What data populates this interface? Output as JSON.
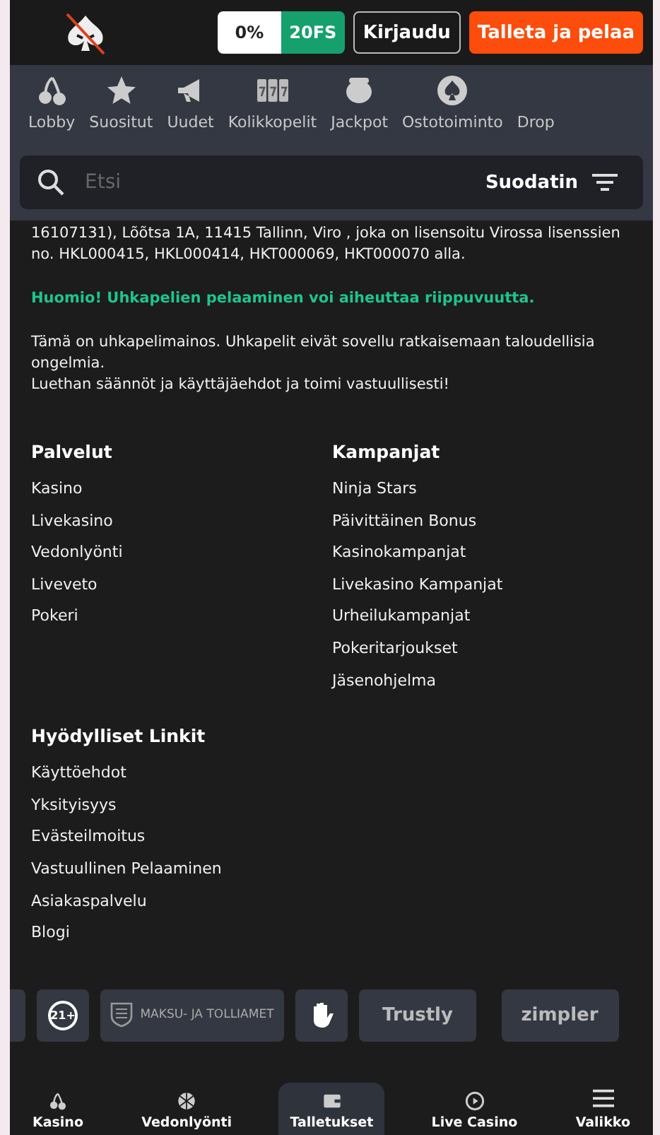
{
  "header": {
    "bonus_percent": "0%",
    "bonus_spins": "20FS",
    "login": "Kirjaudu",
    "deposit": "Talleta ja pelaa"
  },
  "categories": [
    {
      "label": "Lobby"
    },
    {
      "label": "Suositut"
    },
    {
      "label": "Uudet"
    },
    {
      "label": "Kolikkopelit"
    },
    {
      "label": "Jackpot"
    },
    {
      "label": "Ostotoiminto"
    },
    {
      "label": "Drop"
    }
  ],
  "search": {
    "placeholder": "Etsi",
    "filter": "Suodatin"
  },
  "legal": {
    "license": "16107131), Lõõtsa 1A, 11415 Tallinn, Viro , joka on lisensoitu Virossa lisenssien no. HKL000415, HKL000414, HKT000069, HKT000070 alla.",
    "warning": "Huomio! Uhkapelien pelaaminen voi aiheuttaa riippuvuutta.",
    "notice": "Tämä on uhkapelimainos. Uhkapelit eivät sovellu ratkaisemaan taloudellisia ongelmia.",
    "advice": "Luethan säännöt ja käyttäjäehdot ja toimi vastuullisesti!"
  },
  "columns": [
    {
      "title": "Palvelut",
      "links": [
        "Kasino",
        "Livekasino",
        "Vedonlyönti",
        "Liveveto",
        "Pokeri"
      ]
    },
    {
      "title": "Kampanjat",
      "links": [
        "Ninja Stars",
        "Päivittäinen Bonus",
        "Kasinokampanjat",
        "Livekasino Kampanjat",
        "Urheilukampanjat",
        "Pokeritarjoukset",
        "Jäsenohjelma"
      ]
    },
    {
      "title": "Hyödylliset Linkit",
      "links": [
        "Käyttöehdot",
        "Yksityisyys",
        "Evästeilmoitus",
        "Vastuullinen Pelaaminen",
        "Asiakaspalvelu",
        "Blogi"
      ]
    }
  ],
  "badges": [
    {
      "kind": "cut"
    },
    {
      "kind": "text",
      "text": "21+"
    },
    {
      "kind": "emblem",
      "text": "MAKSU- JA TOLLIAMET"
    },
    {
      "kind": "hand"
    },
    {
      "kind": "logo",
      "text": "Trustly"
    },
    {
      "kind": "logo",
      "text": "zimpler"
    }
  ],
  "bottom_nav": [
    {
      "label": "Kasino",
      "selected": false
    },
    {
      "label": "Vedonlyönti",
      "selected": false
    },
    {
      "label": "Talletukset",
      "selected": true
    },
    {
      "label": "Live Casino",
      "selected": false
    },
    {
      "label": "Valikko",
      "selected": false
    }
  ]
}
